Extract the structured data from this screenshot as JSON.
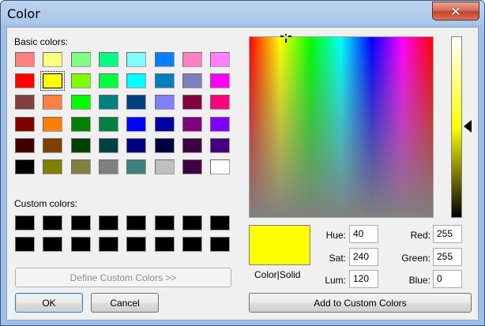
{
  "window": {
    "title": "Color"
  },
  "colors": {
    "selected": "#ffff00",
    "custom_slot": "#000000"
  },
  "basic_colors": {
    "label": "Basic colors:",
    "rows": [
      [
        "#ff8080",
        "#ffff80",
        "#80ff80",
        "#00ff80",
        "#80ffff",
        "#0080ff",
        "#ff80c0",
        "#ff80ff"
      ],
      [
        "#ff0000",
        "#ffff00",
        "#80ff00",
        "#00ff40",
        "#00ffff",
        "#0080c0",
        "#8080c0",
        "#ff00ff"
      ],
      [
        "#804040",
        "#ff8040",
        "#00ff00",
        "#008080",
        "#004080",
        "#8080ff",
        "#800040",
        "#ff0080"
      ],
      [
        "#800000",
        "#ff8000",
        "#008000",
        "#008040",
        "#0000ff",
        "#0000a0",
        "#800080",
        "#8000ff"
      ],
      [
        "#400000",
        "#804000",
        "#004000",
        "#004040",
        "#000080",
        "#000040",
        "#400040",
        "#400080"
      ],
      [
        "#000000",
        "#808000",
        "#808040",
        "#808080",
        "#408080",
        "#c0c0c0",
        "#400040",
        "#ffffff"
      ]
    ]
  },
  "custom_colors": {
    "label": "Custom colors:"
  },
  "buttons": {
    "define_custom": "Define Custom Colors >>",
    "ok": "OK",
    "cancel": "Cancel",
    "add_custom": "Add to Custom Colors"
  },
  "preview": {
    "label": "Color|Solid"
  },
  "fields": {
    "hue": {
      "label": "Hue:",
      "value": "40"
    },
    "sat": {
      "label": "Sat:",
      "value": "240"
    },
    "lum": {
      "label": "Lum:",
      "value": "120"
    },
    "red": {
      "label": "Red:",
      "value": "255"
    },
    "green": {
      "label": "Green:",
      "value": "255"
    },
    "blue": {
      "label": "Blue:",
      "value": "0"
    }
  }
}
